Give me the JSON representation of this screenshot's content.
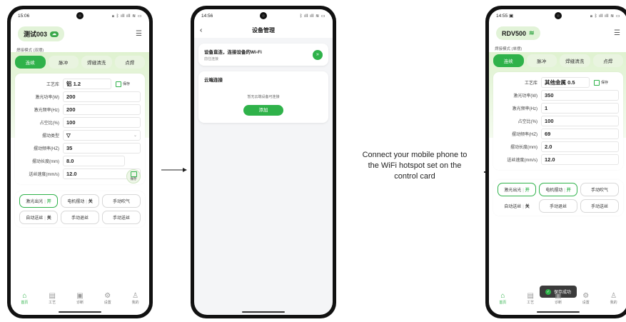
{
  "phone1": {
    "status": {
      "time": "15:06",
      "icons": "⌧ ᛒ ıll ıll ≋ ▭"
    },
    "title": "测试003",
    "mode_label": "焊接模式 (双摆)",
    "tabs": [
      {
        "label": "连续"
      },
      {
        "label": "脉冲"
      },
      {
        "label": "焊缝清洗"
      },
      {
        "label": "点焊"
      }
    ],
    "fields": [
      {
        "label": "工艺库",
        "value": "铝  1.2"
      },
      {
        "label": "激光功率(W)",
        "value": "200"
      },
      {
        "label": "激光频率(Hz)",
        "value": "200"
      },
      {
        "label": "占空比(%)",
        "value": "100"
      },
      {
        "label": "摆动类型",
        "value": "▽"
      },
      {
        "label": "摆动频率(HZ)",
        "value": "35"
      },
      {
        "label": "摆动长度(mm)",
        "value": "8.0"
      },
      {
        "label": "送丝速度(mm/s)",
        "value": "12.0"
      }
    ],
    "save_label": "保存",
    "float_save_label": "保存",
    "buttons": [
      {
        "label": "激光出光",
        "state": "开",
        "state_kind": "on"
      },
      {
        "label": "电机摆动",
        "state": "关",
        "state_kind": "off"
      },
      {
        "label": "手动吹气"
      },
      {
        "label": "自动送丝",
        "state": "关",
        "state_kind": "off"
      },
      {
        "label": "手动退丝"
      },
      {
        "label": "手动送丝"
      }
    ],
    "nav": [
      {
        "label": "首页",
        "icon": "⌂"
      },
      {
        "label": "工艺",
        "icon": "▤"
      },
      {
        "label": "诊断",
        "icon": "▣"
      },
      {
        "label": "设置",
        "icon": "⚙"
      },
      {
        "label": "我的",
        "icon": "♙"
      }
    ]
  },
  "phone2": {
    "status": {
      "time": "14:56",
      "icons": "ᛒ ıll ıll ≋ ▭"
    },
    "title": "设备管理",
    "wifi_card": {
      "title": "设备直连，连接设备的Wi-Fi",
      "sub": "前往连接"
    },
    "cloud_card": {
      "title": "云端连接",
      "empty": "暂无云端设备可连接",
      "add": "添加"
    }
  },
  "caption": "Connect your mobile phone to the WiFi hotspot set on the control card",
  "phone3": {
    "status": {
      "time": "14:55 ▣",
      "icons": "⌧ ᛒ ıll ıll ≋ ▭"
    },
    "title": "RDV500",
    "mode_label": "焊接模式 (单摆)",
    "tabs": [
      {
        "label": "连续"
      },
      {
        "label": "脉冲"
      },
      {
        "label": "焊缝清洗"
      },
      {
        "label": "点焊"
      }
    ],
    "fields": [
      {
        "label": "工艺库",
        "value": "其他金属  0.5"
      },
      {
        "label": "激光功率(W)",
        "value": "350"
      },
      {
        "label": "激光频率(Hz)",
        "value": "1"
      },
      {
        "label": "占空比(%)",
        "value": "100"
      },
      {
        "label": "摆动频率(HZ)",
        "value": "69"
      },
      {
        "label": "摆动长度(mm)",
        "value": "2.0"
      },
      {
        "label": "送丝速度(mm/s)",
        "value": "12.0"
      }
    ],
    "save_label": "保存",
    "buttons": [
      {
        "label": "激光出光",
        "state": "开",
        "state_kind": "on"
      },
      {
        "label": "电机摆动",
        "state": "开",
        "state_kind": "on"
      },
      {
        "label": "手动吹气"
      },
      {
        "label": "自动送丝",
        "state": "关",
        "state_kind": "off"
      },
      {
        "label": "手动退丝"
      },
      {
        "label": "手动送丝"
      }
    ],
    "toast": "保存成功",
    "nav": [
      {
        "label": "首页",
        "icon": "⌂"
      },
      {
        "label": "工艺",
        "icon": "▤"
      },
      {
        "label": "诊断",
        "icon": "▣"
      },
      {
        "label": "设置",
        "icon": "⚙"
      },
      {
        "label": "我的",
        "icon": "♙"
      }
    ]
  },
  "colors": {
    "accent": "#2fb24a",
    "header_tint": "#dff2d0"
  }
}
